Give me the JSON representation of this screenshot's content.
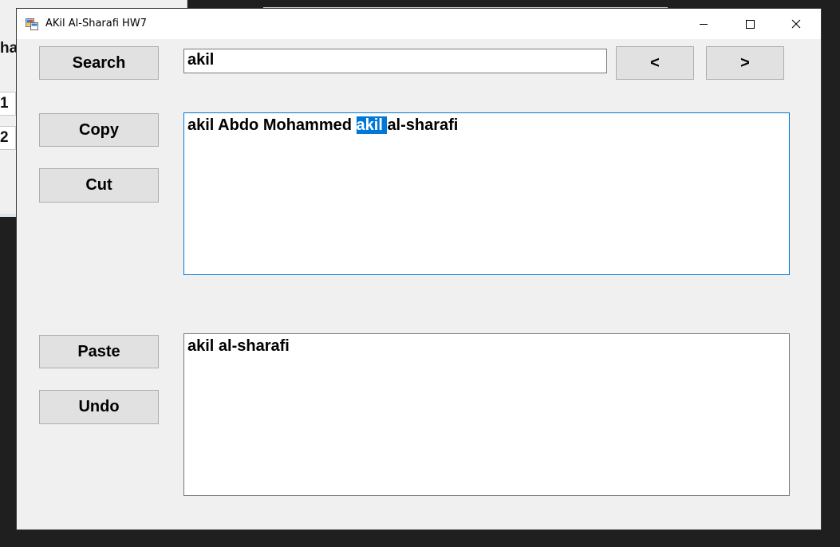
{
  "background_window": {
    "fragment_text": "ha",
    "cell_1": "1",
    "cell_2": "2"
  },
  "window": {
    "title": "AKil Al-Sharafi HW7",
    "controls": {
      "minimize_icon": "minimize-icon",
      "maximize_icon": "maximize-icon",
      "close_icon": "close-icon"
    }
  },
  "buttons": {
    "search": "Search",
    "copy": "Copy",
    "cut": "Cut",
    "paste": "Paste",
    "undo": "Undo",
    "prev": "<",
    "next": ">"
  },
  "search": {
    "value": "akil"
  },
  "main_text": {
    "before": "akil Abdo Mohammed ",
    "selected": "akil ",
    "after": "al-sharafi"
  },
  "clipboard_text": {
    "value": "akil al-sharafi"
  },
  "colors": {
    "selection": "#0078d7",
    "focus_border": "#0078d7",
    "button_face": "#e1e1e1",
    "window_bg": "#f0f0f0"
  }
}
